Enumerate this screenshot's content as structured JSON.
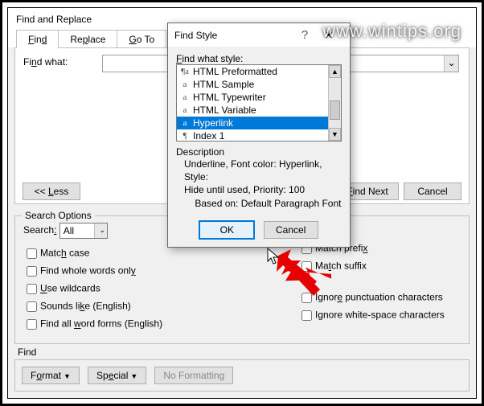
{
  "watermark": "www.wintips.org",
  "main": {
    "title": "Find and Replace",
    "tabs": {
      "find": "Find",
      "replace": "Replace",
      "goto": "Go To"
    },
    "find_what_label": "Find what:",
    "less_btn": "<< Less",
    "find_next_btn": "Find Next",
    "cancel_btn": "Cancel",
    "search_options_legend": "Search Options",
    "search_label": "Search:",
    "search_value": "All",
    "checks": {
      "match_case": "Match case",
      "whole_words": "Find whole words only",
      "wildcards": "Use wildcards",
      "sounds_like": "Sounds like (English)",
      "word_forms": "Find all word forms (English)",
      "prefix": "Match prefix",
      "suffix": "Match suffix",
      "ignore_punct": "Ignore punctuation characters",
      "ignore_ws": "Ignore white-space characters"
    },
    "find_section_label": "Find",
    "format_btn": "Format",
    "special_btn": "Special",
    "no_formatting_btn": "No Formatting"
  },
  "modal": {
    "title": "Find Style",
    "list_label": "Find what style:",
    "items": [
      {
        "icon": "¶a",
        "label": "HTML Preformatted"
      },
      {
        "icon": "a",
        "label": "HTML Sample"
      },
      {
        "icon": "a",
        "label": "HTML Typewriter"
      },
      {
        "icon": "a",
        "label": "HTML Variable"
      },
      {
        "icon": "a",
        "label": "Hyperlink",
        "selected": true
      },
      {
        "icon": "¶",
        "label": "Index 1"
      }
    ],
    "desc_label": "Description",
    "desc_line1": "Underline, Font color: Hyperlink, Style:",
    "desc_line2": "Hide until used, Priority: 100",
    "desc_line3": "Based on: Default Paragraph Font",
    "ok": "OK",
    "cancel": "Cancel"
  }
}
